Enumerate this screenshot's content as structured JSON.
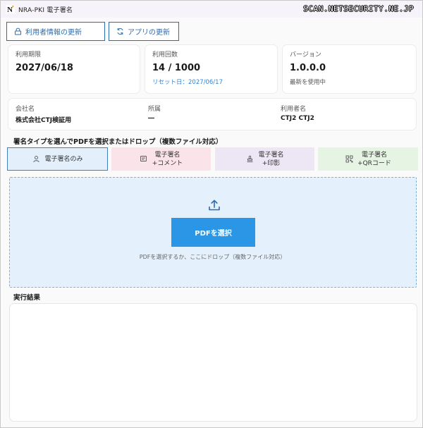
{
  "window": {
    "title": "NRA-PKI 電子署名",
    "logo_text": "N",
    "watermark": "SCAN.NETSECURITY.NE.JP"
  },
  "toolbar": {
    "update_user_info": "利用者情報の更新",
    "update_app": "アプリの更新"
  },
  "stats": {
    "expiry": {
      "label": "利用期限",
      "value": "2027/06/18"
    },
    "usage": {
      "label": "利用回数",
      "value": "14 / 1000",
      "reset_label": "リセット日：2027/06/17"
    },
    "version": {
      "label": "バージョン",
      "value": "1.0.0.0",
      "status": "最新を使用中"
    }
  },
  "info": {
    "company": {
      "label": "会社名",
      "value": "株式会社CTJ検証用"
    },
    "department": {
      "label": "所属",
      "value": "―"
    },
    "user": {
      "label": "利用者名",
      "value": "CTJ2 CTJ2"
    }
  },
  "signature_section": {
    "heading": "署名タイプを選んでPDFを選択またはドロップ（複数ファイル対応）",
    "types": [
      {
        "label": "電子署名のみ",
        "icon": "user-icon",
        "selected": true,
        "bg": "#e3f0fb"
      },
      {
        "label": "電子署名",
        "sublabel": "+コメント",
        "icon": "comment-icon",
        "selected": false,
        "bg": "#fbe3ea"
      },
      {
        "label": "電子署名",
        "sublabel": "+印影",
        "icon": "stamp-icon",
        "selected": false,
        "bg": "#ede6f5"
      },
      {
        "label": "電子署名",
        "sublabel": "+QRコード",
        "icon": "qr-icon",
        "selected": false,
        "bg": "#e5f4e3"
      }
    ]
  },
  "dropzone": {
    "button_label": "PDFを選択",
    "hint": "PDFを選択するか、ここにドロップ（複数ファイル対応）",
    "icon": "upload-icon"
  },
  "results": {
    "heading": "実行結果"
  },
  "colors": {
    "accent": "#2b96e6",
    "link": "#2f86d9",
    "border_blue": "#2b6cb0"
  }
}
